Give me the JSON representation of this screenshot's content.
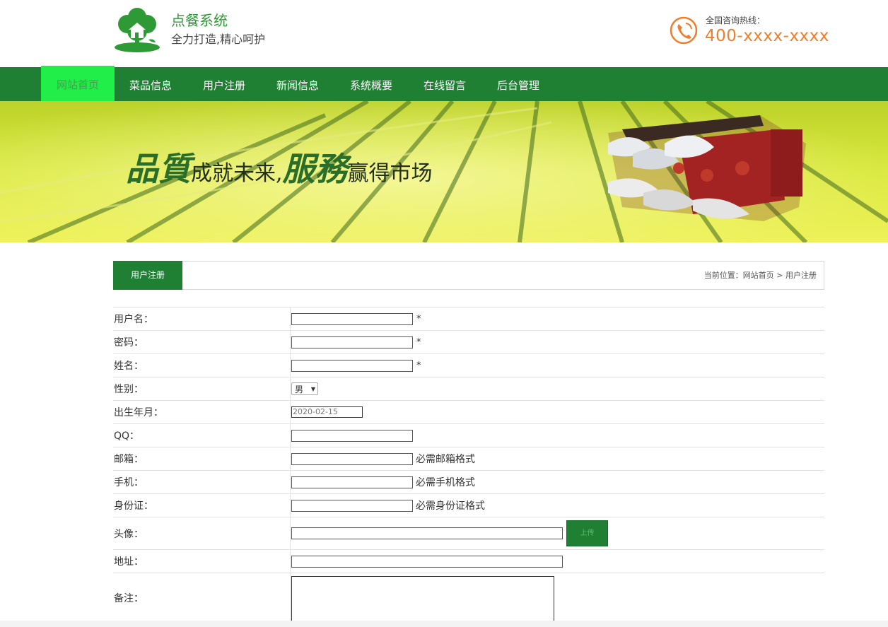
{
  "header": {
    "site_title": "点餐系统",
    "site_slogan": "全力打造,精心呵护",
    "hotline_label": "全国咨询热线：",
    "hotline_number": "400-xxxx-xxxx",
    "logo_icon": "house-tree-logo-icon",
    "phone_icon": "phone-icon"
  },
  "nav": {
    "items": [
      {
        "label": "网站首页",
        "active": true
      },
      {
        "label": "菜品信息",
        "active": false
      },
      {
        "label": "用户注册",
        "active": false
      },
      {
        "label": "新闻信息",
        "active": false
      },
      {
        "label": "系统概要",
        "active": false
      },
      {
        "label": "在线留言",
        "active": false
      },
      {
        "label": "后台管理",
        "active": false
      }
    ]
  },
  "banner": {
    "word1": "品質",
    "text1": "成就未来,",
    "word2": "服務",
    "text2": "赢得市场"
  },
  "section": {
    "tab_label": "用户注册",
    "breadcrumb_prefix": "当前位置：",
    "breadcrumb_home": "网站首页",
    "breadcrumb_sep": " > ",
    "breadcrumb_current": "用户注册"
  },
  "form": {
    "username_label": "用户名：",
    "password_label": "密码：",
    "name_label": "姓名：",
    "gender_label": "性别：",
    "gender_value": "男",
    "birth_label": "出生年月：",
    "birth_value": "2020-02-15",
    "qq_label": "QQ：",
    "email_label": "邮箱：",
    "email_hint": "必需邮箱格式",
    "phone_label": "手机：",
    "phone_hint": "必需手机格式",
    "idcard_label": "身份证：",
    "idcard_hint": "必需身份证格式",
    "avatar_label": "头像：",
    "upload_label": "上传",
    "address_label": "地址：",
    "remark_label": "备注：",
    "required_mark": "*"
  },
  "colors": {
    "brand_green": "#1f8034",
    "active_nav": "#22ee4a",
    "hotline_orange": "#ef7d2c"
  }
}
